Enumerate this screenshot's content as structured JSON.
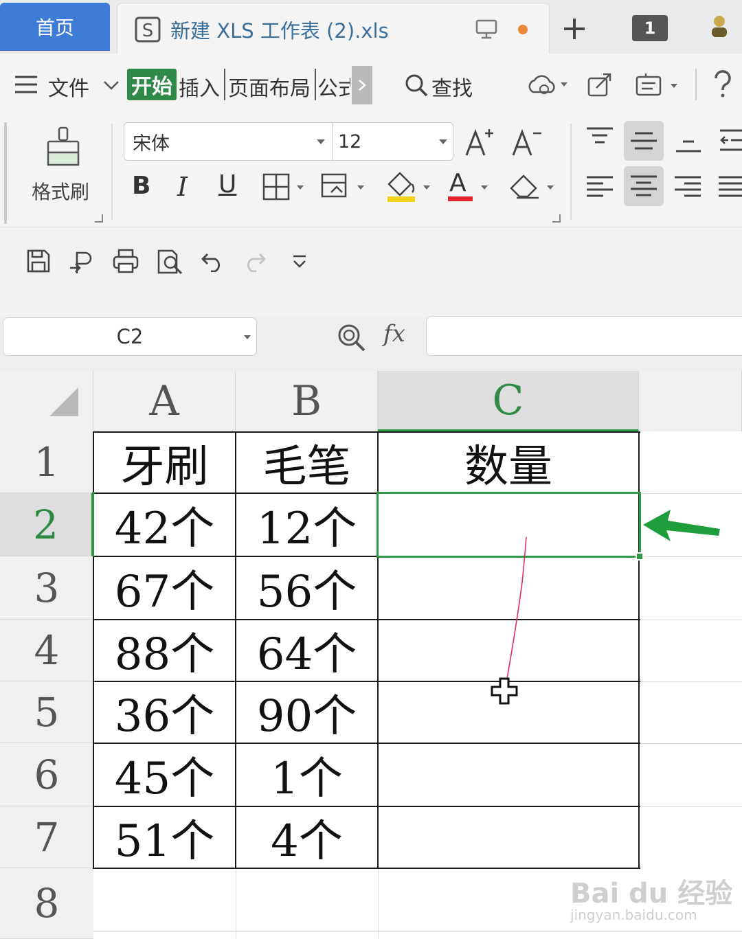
{
  "tabs": {
    "home_label": "首页",
    "file_name": "新建 XLS 工作表 (2).xls",
    "sheet_count": "1"
  },
  "menu": {
    "file": "文件",
    "start": "开始",
    "insert": "插入",
    "page_layout": "页面布局",
    "formula": "公式",
    "find": "查找"
  },
  "ribbon": {
    "format_painter": "格式刷",
    "font_name": "宋体",
    "font_size": "12",
    "bold": "B",
    "italic": "I",
    "underline": "U",
    "font_color_glyph": "A",
    "font_color": "#e0202a",
    "fill_color": "#f5d21a"
  },
  "formula_bar": {
    "cell_ref": "C2",
    "fx": "fx",
    "value": ""
  },
  "grid": {
    "columns": [
      "A",
      "B",
      "C"
    ],
    "rows": [
      "1",
      "2",
      "3",
      "4",
      "5",
      "6",
      "7",
      "8"
    ],
    "selected_column": "C",
    "selected_row": "2",
    "cells": [
      [
        "牙刷",
        "毛笔",
        "数量"
      ],
      [
        "42个",
        "12个",
        ""
      ],
      [
        "67个",
        "56个",
        ""
      ],
      [
        "88个",
        "64个",
        ""
      ],
      [
        "36个",
        "90个",
        ""
      ],
      [
        "45个",
        "1个",
        ""
      ],
      [
        "51个",
        "4个",
        ""
      ],
      [
        "",
        "",
        ""
      ]
    ],
    "selection_color": "#2e9a45",
    "arrow_color": "#1e9e3a"
  },
  "watermark": {
    "brand": "Bai du 经验",
    "url": "jingyan.baidu.com"
  }
}
